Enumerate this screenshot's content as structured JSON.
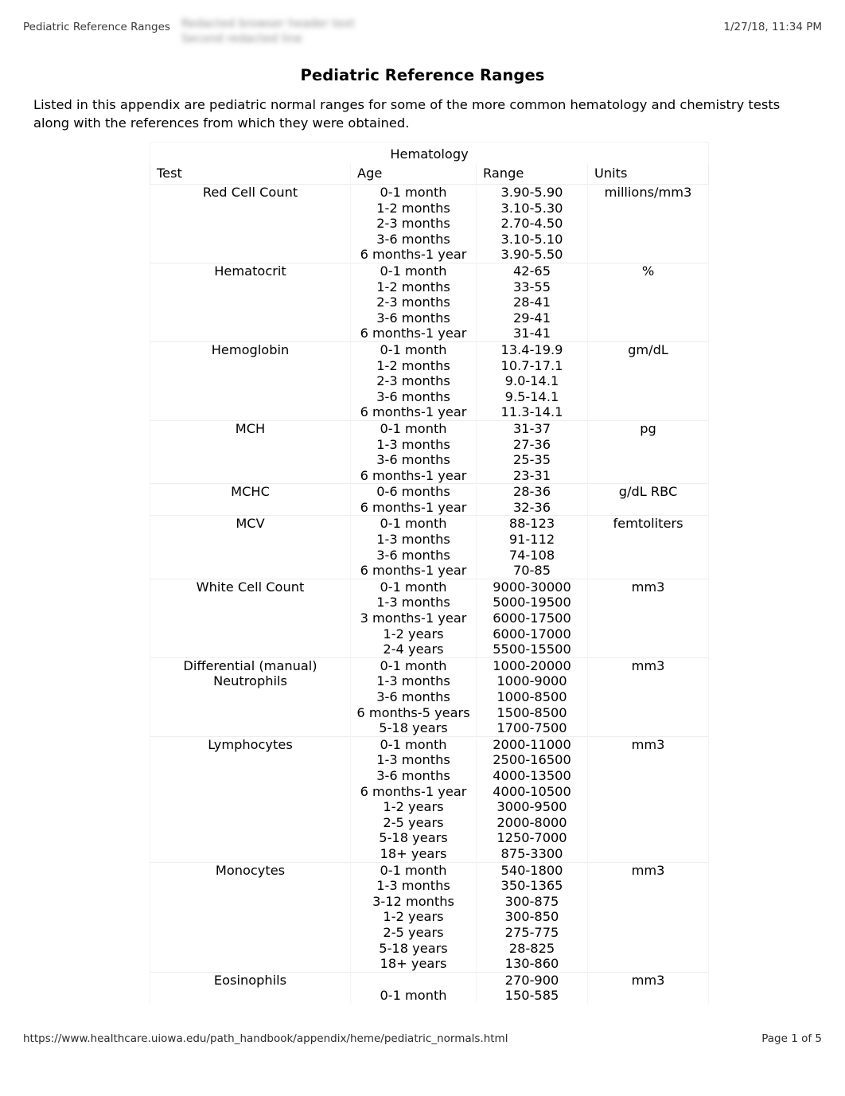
{
  "print_header": {
    "left_title": "Pediatric Reference Ranges",
    "redacted_text": "Redacted browser header text\nSecond redacted line",
    "right_timestamp": "1/27/18, 11:34 PM"
  },
  "document": {
    "title": "Pediatric Reference Ranges",
    "intro": "Listed in this appendix are pediatric normal ranges for some of the more common hematology and chemistry tests along with the references from which they were obtained."
  },
  "table": {
    "section_title": "Hematology",
    "columns": [
      "Test",
      "Age",
      "Range",
      "Units"
    ],
    "rows": [
      {
        "test": "Red Cell Count",
        "ages": [
          "0-1 month",
          "1-2 months",
          "2-3 months",
          "3-6 months",
          "6 months-1 year"
        ],
        "ranges": [
          "3.90-5.90",
          "3.10-5.30",
          "2.70-4.50",
          "3.10-5.10",
          "3.90-5.50"
        ],
        "units": "millions/mm3"
      },
      {
        "test": "Hematocrit",
        "ages": [
          "0-1 month",
          "1-2 months",
          "2-3 months",
          "3-6 months",
          "6 months-1 year"
        ],
        "ranges": [
          "42-65",
          "33-55",
          "28-41",
          "29-41",
          "31-41"
        ],
        "units": "%"
      },
      {
        "test": "Hemoglobin",
        "ages": [
          "0-1 month",
          "1-2 months",
          "2-3 months",
          "3-6 months",
          "6 months-1 year"
        ],
        "ranges": [
          "13.4-19.9",
          "10.7-17.1",
          "9.0-14.1",
          "9.5-14.1",
          "11.3-14.1"
        ],
        "units": "gm/dL"
      },
      {
        "test": "MCH",
        "ages": [
          "0-1 month",
          "1-3 months",
          "3-6 months",
          "6 months-1 year"
        ],
        "ranges": [
          "31-37",
          "27-36",
          "25-35",
          "23-31"
        ],
        "units": "pg"
      },
      {
        "test": "MCHC",
        "ages": [
          "0-6 months",
          "6 months-1 year"
        ],
        "ranges": [
          "28-36",
          "32-36"
        ],
        "units": "g/dL RBC"
      },
      {
        "test": "MCV",
        "ages": [
          "0-1 month",
          "1-3 months",
          "3-6 months",
          "6 months-1 year"
        ],
        "ranges": [
          "88-123",
          "91-112",
          "74-108",
          "70-85"
        ],
        "units": "femtoliters"
      },
      {
        "test": "White Cell Count",
        "ages": [
          "0-1 month",
          "1-3 months",
          "3 months-1 year",
          "1-2 years",
          "2-4 years"
        ],
        "ranges": [
          "9000-30000",
          "5000-19500",
          "6000-17500",
          "6000-17000",
          "5500-15500"
        ],
        "units": "mm3"
      },
      {
        "test": "Differential (manual)\nNeutrophils",
        "ages": [
          "0-1 month",
          "1-3 months",
          "3-6 months",
          "6 months-5 years",
          "5-18 years"
        ],
        "ranges": [
          "1000-20000",
          "1000-9000",
          "1000-8500",
          "1500-8500",
          "1700-7500"
        ],
        "units": "mm3"
      },
      {
        "test": "Lymphocytes",
        "ages": [
          "0-1 month",
          "1-3 months",
          "3-6 months",
          "6 months-1 year",
          "1-2 years",
          "2-5 years",
          "5-18 years",
          "18+ years"
        ],
        "ranges": [
          "2000-11000",
          "2500-16500",
          "4000-13500",
          "4000-10500",
          "3000-9500",
          "2000-8000",
          "1250-7000",
          "875-3300"
        ],
        "units": "mm3"
      },
      {
        "test": "Monocytes",
        "ages": [
          "0-1 month",
          "1-3 months",
          "3-12 months",
          "1-2 years",
          "2-5 years",
          "5-18 years",
          "18+ years"
        ],
        "ranges": [
          "540-1800",
          "350-1365",
          "300-875",
          "300-850",
          "275-775",
          "28-825",
          "130-860"
        ],
        "units": "mm3"
      },
      {
        "test": "Eosinophils",
        "ages": [
          "",
          "0-1 month"
        ],
        "ranges": [
          "270-900",
          "150-585"
        ],
        "units": "mm3"
      }
    ]
  },
  "print_footer": {
    "url": "https://www.healthcare.uiowa.edu/path_handbook/appendix/heme/pediatric_normals.html",
    "page_label": "Page 1 of 5"
  }
}
